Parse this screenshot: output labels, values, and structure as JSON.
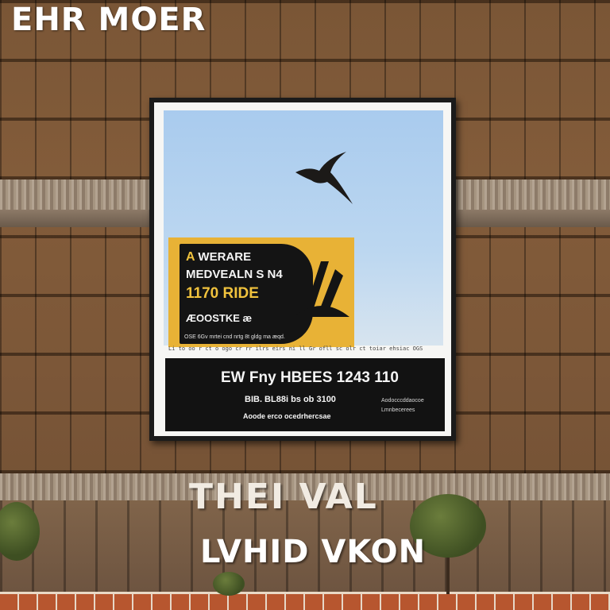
{
  "header": {
    "title": "EHR MOER"
  },
  "poster": {
    "card": {
      "line1_a": "A",
      "line1_b": "WERARE",
      "line2": "MEDVEALN S N4",
      "line3": "1170 RIDE",
      "line4": "ÆOOSTKE æ",
      "fine": "OSE 6Gv mrtei cnd nrtg 8t gldg ma æqd."
    },
    "fine_print": "Li to oo r ct o ogo cr rr ilrs eirs ni ll Gr ofll sc olr ct toiar ehsiac OGS",
    "band": {
      "headline": "EW Fny HBEES  1243  110",
      "line2": "BIB. BL88i bs ob 3100",
      "line3": "Aoode erco ocedrhercsae",
      "side1": "Aodocccddaocoe",
      "side2": "Lmnbecerees"
    }
  },
  "wall": {
    "line1": "THEI VAL",
    "line2": "LVHID VKON"
  },
  "colors": {
    "accent_yellow": "#e8b236",
    "panel_black": "#121212",
    "sky_blue": "#a9cbee"
  }
}
